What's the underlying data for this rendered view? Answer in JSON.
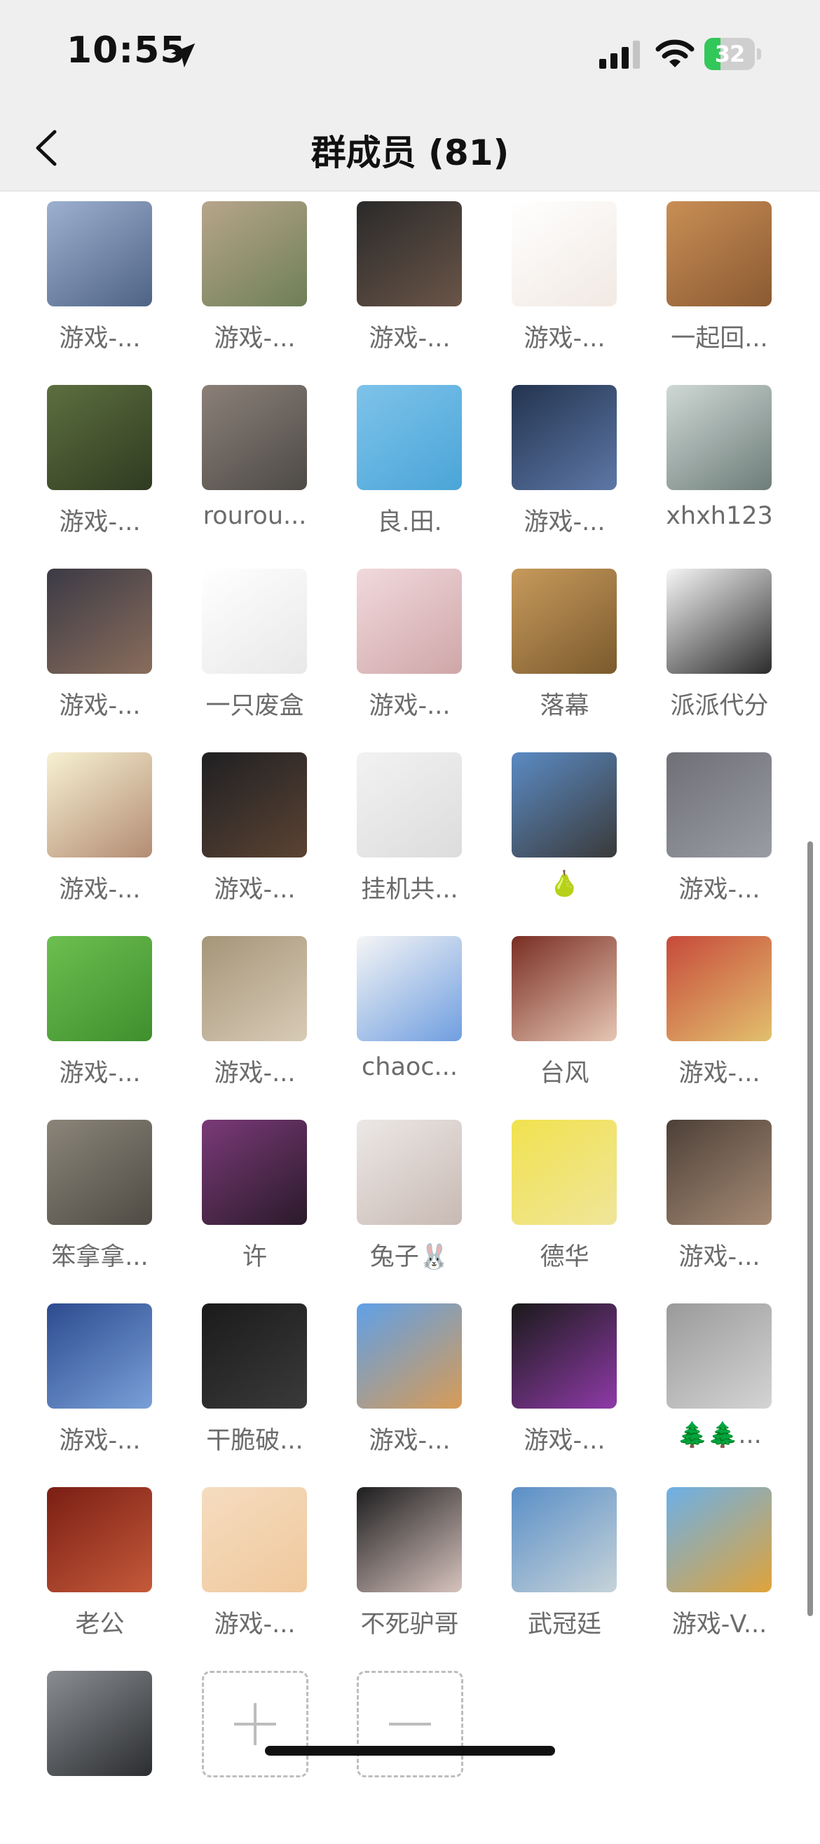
{
  "status_bar": {
    "time": "10:55",
    "battery": "32",
    "battery_level": 0.32,
    "icons": [
      "location-arrow-icon",
      "cellular-signal-icon",
      "wifi-icon",
      "battery-charging-icon"
    ]
  },
  "nav": {
    "title": "群成员 (81)",
    "back_icon": "chevron-left-icon"
  },
  "members": [
    {
      "name": "游戏-...",
      "c1": "#9db0cf",
      "c2": "#4f6386"
    },
    {
      "name": "游戏-...",
      "c1": "#b7a58a",
      "c2": "#6e7f58"
    },
    {
      "name": "游戏-...",
      "c1": "#2a2a2a",
      "c2": "#6a5548"
    },
    {
      "name": "游戏-...",
      "c1": "#ffffff",
      "c2": "#f1e9e3"
    },
    {
      "name": "一起回...",
      "c1": "#c98e55",
      "c2": "#8a5a32"
    },
    {
      "name": "游戏-...",
      "c1": "#5d6f3f",
      "c2": "#2f3b21"
    },
    {
      "name": "rourou...",
      "c1": "#8b8078",
      "c2": "#4d4a47"
    },
    {
      "name": "良.田.",
      "c1": "#7ec3ea",
      "c2": "#4aa5d8"
    },
    {
      "name": "游戏-...",
      "c1": "#23344f",
      "c2": "#5d77a6"
    },
    {
      "name": "xhxh123",
      "c1": "#cfd8d5",
      "c2": "#6d7d79"
    },
    {
      "name": "游戏-...",
      "c1": "#3b3a45",
      "c2": "#8a6d5c"
    },
    {
      "name": "一只废盒",
      "c1": "#ffffff",
      "c2": "#e8e8e8"
    },
    {
      "name": "游戏-...",
      "c1": "#f1d9dc",
      "c2": "#cfa6a8"
    },
    {
      "name": "落幕",
      "c1": "#c79a5c",
      "c2": "#7b5a2d"
    },
    {
      "name": "派派代分",
      "c1": "#f6f6f6",
      "c2": "#2b2b2b"
    },
    {
      "name": "游戏-...",
      "c1": "#f7f1d2",
      "c2": "#b38c73"
    },
    {
      "name": "游戏-...",
      "c1": "#1f2023",
      "c2": "#5b4333"
    },
    {
      "name": "挂机共...",
      "c1": "#f2f2f2",
      "c2": "#dcdcdc"
    },
    {
      "name": "🍐",
      "c1": "#5b8bc4",
      "c2": "#3a3a3a"
    },
    {
      "name": "游戏-...",
      "c1": "#6f7076",
      "c2": "#9a9ca4"
    },
    {
      "name": "游戏-...",
      "c1": "#6cbf4f",
      "c2": "#3f8f2e"
    },
    {
      "name": "游戏-...",
      "c1": "#a59579",
      "c2": "#d8cbb6"
    },
    {
      "name": "chaoc...",
      "c1": "#f5f5f5",
      "c2": "#6f9ee0"
    },
    {
      "name": "台风",
      "c1": "#7a2e23",
      "c2": "#e6c6b4"
    },
    {
      "name": "游戏-...",
      "c1": "#c74a3a",
      "c2": "#e2c06e"
    },
    {
      "name": "笨拿拿...",
      "c1": "#8a8579",
      "c2": "#4f4b44"
    },
    {
      "name": "许",
      "c1": "#7a3a78",
      "c2": "#2a1a2a"
    },
    {
      "name": "兔子🐰",
      "c1": "#ece8e6",
      "c2": "#c8b9b3"
    },
    {
      "name": "德华",
      "c1": "#f1e24f",
      "c2": "#f0e59a"
    },
    {
      "name": "游戏-...",
      "c1": "#4d4038",
      "c2": "#a58a74"
    },
    {
      "name": "游戏-...",
      "c1": "#2c4b8f",
      "c2": "#7aa0d8"
    },
    {
      "name": "干脆破...",
      "c1": "#1b1b1b",
      "c2": "#3a3a3a"
    },
    {
      "name": "游戏-...",
      "c1": "#5fa0e8",
      "c2": "#d89b55"
    },
    {
      "name": "游戏-...",
      "c1": "#1a1a1a",
      "c2": "#8f3aa8"
    },
    {
      "name": "🌲🌲...",
      "c1": "#9a9a9a",
      "c2": "#d4d4d4"
    },
    {
      "name": "老公",
      "c1": "#7a1e14",
      "c2": "#c55a3a"
    },
    {
      "name": "游戏-...",
      "c1": "#f5dcc0",
      "c2": "#f0c89c"
    },
    {
      "name": "不死驴哥",
      "c1": "#1d1d1f",
      "c2": "#d7c3bd"
    },
    {
      "name": "武冠廷",
      "c1": "#5a8fc7",
      "c2": "#c7d3d9"
    },
    {
      "name": "游戏-V...",
      "c1": "#6cb0e8",
      "c2": "#e0a33a"
    },
    {
      "name": "",
      "c1": "#8a8d92",
      "c2": "#2b2d30"
    }
  ],
  "actions": {
    "add_icon": "plus-icon",
    "remove_icon": "minus-icon"
  }
}
